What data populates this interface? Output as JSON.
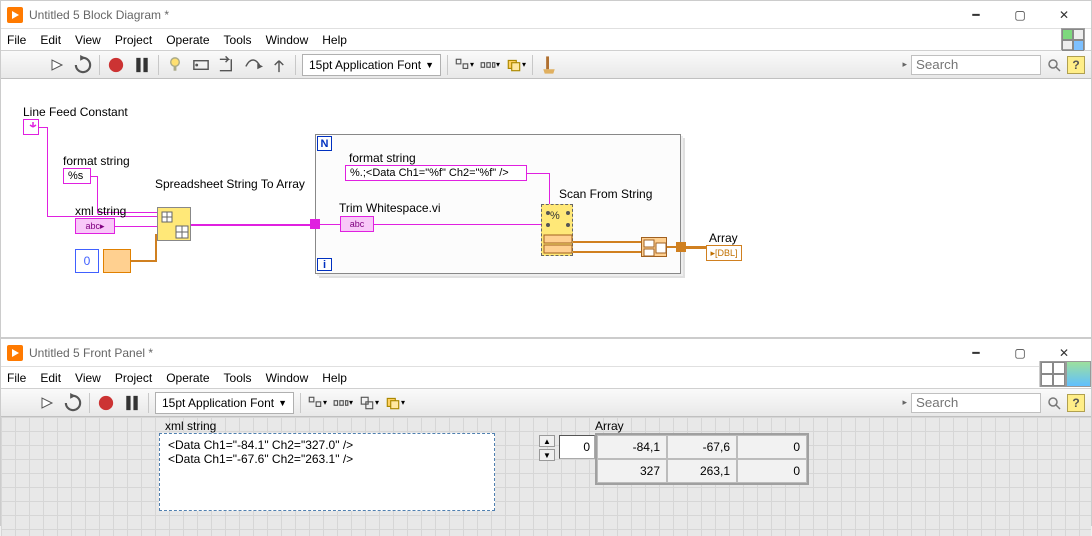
{
  "block_diagram": {
    "title": "Untitled 5 Block Diagram *",
    "menu": [
      "File",
      "Edit",
      "View",
      "Project",
      "Operate",
      "Tools",
      "Window",
      "Help"
    ],
    "font": "15pt Application Font",
    "search_placeholder": "Search",
    "labels": {
      "line_feed": "Line Feed Constant",
      "format_string_outer": "format string",
      "format_value_outer": "%s",
      "spreadsheet_fn": "Spreadsheet String To Array",
      "xml_string": "xml string",
      "index_const": "0",
      "loop_N": "N",
      "loop_i": "i",
      "format_string_inner": "format string",
      "format_value_inner": "%.;<Data Ch1=\"%f\" Ch2=\"%f\" />",
      "trim_fn": "Trim Whitespace.vi",
      "scan_fn": "Scan From String",
      "array_out": "Array"
    }
  },
  "front_panel": {
    "title": "Untitled 5 Front Panel *",
    "menu": [
      "File",
      "Edit",
      "View",
      "Project",
      "Operate",
      "Tools",
      "Window",
      "Help"
    ],
    "font": "15pt Application Font",
    "search_placeholder": "Search",
    "xml_label": "xml string",
    "xml_lines": [
      "<Data Ch1=\"-84.1\" Ch2=\"327.0\" />",
      "<Data Ch1=\"-67.6\" Ch2=\"263.1\" />"
    ],
    "array_label": "Array",
    "array_index": "0",
    "array_values": [
      [
        "-84,1",
        "-67,6",
        "0"
      ],
      [
        "327",
        "263,1",
        "0"
      ]
    ]
  }
}
